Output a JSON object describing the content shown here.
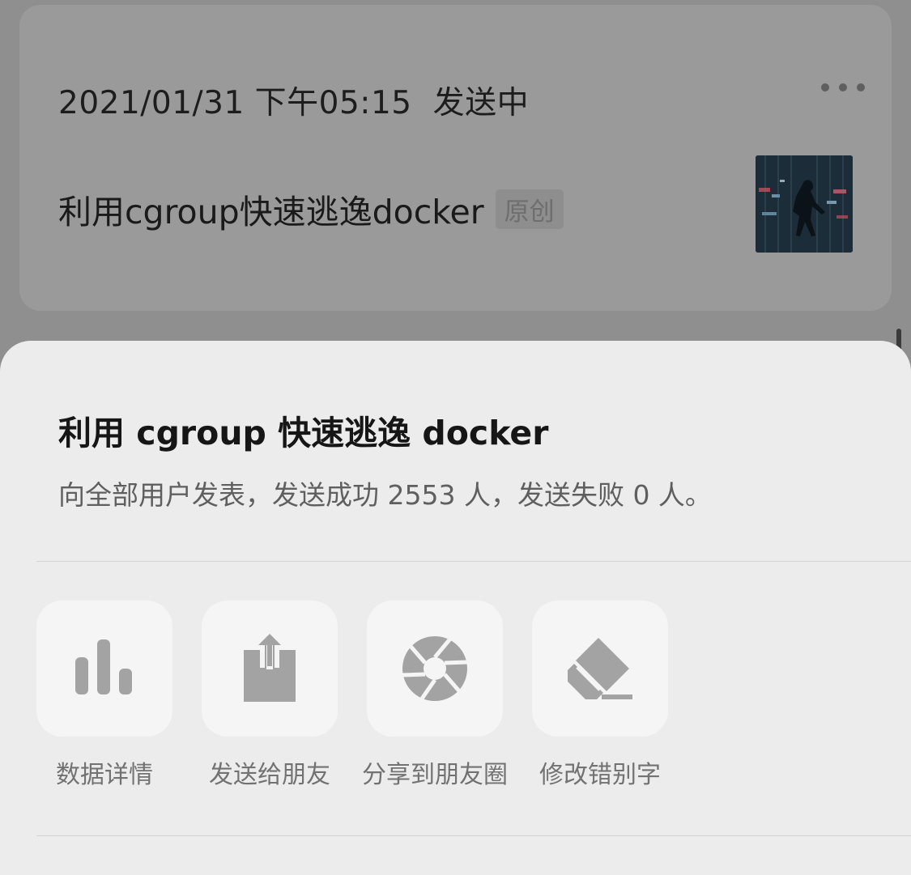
{
  "background_card": {
    "datetime": "2021/01/31 下午05:15",
    "status": "发送中",
    "article_title": "利用cgroup快速逃逸docker",
    "tag": "原创"
  },
  "sheet": {
    "title": "利用 cgroup 快速逃逸 docker",
    "summary": "向全部用户发表，发送成功 2553 人，发送失败 0 人。",
    "actions": [
      {
        "label": "数据详情",
        "icon": "bar-chart-icon"
      },
      {
        "label": "发送给朋友",
        "icon": "share-upload-icon"
      },
      {
        "label": "分享到朋友圈",
        "icon": "moments-aperture-icon"
      },
      {
        "label": "修改错别字",
        "icon": "eraser-icon"
      }
    ]
  },
  "colors": {
    "icon_gray": "#a3a3a3",
    "sheet_bg": "#ececec",
    "tile_bg": "#f5f5f5",
    "overlay_bg": "#8f8f8f"
  }
}
